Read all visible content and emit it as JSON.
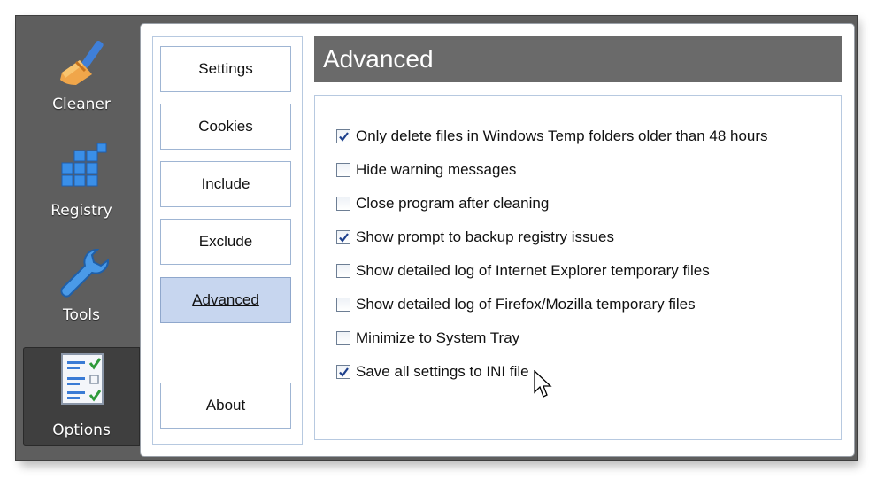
{
  "nav": [
    {
      "label": "Cleaner",
      "icon": "broom-icon",
      "selected": false
    },
    {
      "label": "Registry",
      "icon": "registry-cubes-icon",
      "selected": false
    },
    {
      "label": "Tools",
      "icon": "wrench-icon",
      "selected": false
    },
    {
      "label": "Options",
      "icon": "checklist-icon",
      "selected": true
    }
  ],
  "subnav": [
    {
      "label": "Settings",
      "active": false
    },
    {
      "label": "Cookies",
      "active": false
    },
    {
      "label": "Include",
      "active": false
    },
    {
      "label": "Exclude",
      "active": false
    },
    {
      "label": "Advanced",
      "active": true
    },
    {
      "label": "About",
      "active": false
    }
  ],
  "content": {
    "title": "Advanced",
    "options": [
      {
        "label": "Only delete files in Windows Temp folders older than 48 hours",
        "checked": true
      },
      {
        "label": "Hide warning messages",
        "checked": false
      },
      {
        "label": "Close program after cleaning",
        "checked": false
      },
      {
        "label": "Show prompt to backup registry issues",
        "checked": true
      },
      {
        "label": "Show detailed log of Internet Explorer temporary files",
        "checked": false
      },
      {
        "label": "Show detailed log of Firefox/Mozilla temporary files",
        "checked": false
      },
      {
        "label": "Minimize to System Tray",
        "checked": false
      },
      {
        "label": "Save all settings to INI file",
        "checked": true
      }
    ]
  },
  "colors": {
    "sidebar": "#5e5e5e",
    "selected_nav": "#3f3f3f",
    "header": "#6a6a6a",
    "active_tab": "#c7d6ef",
    "border": "#9fb5d3"
  }
}
